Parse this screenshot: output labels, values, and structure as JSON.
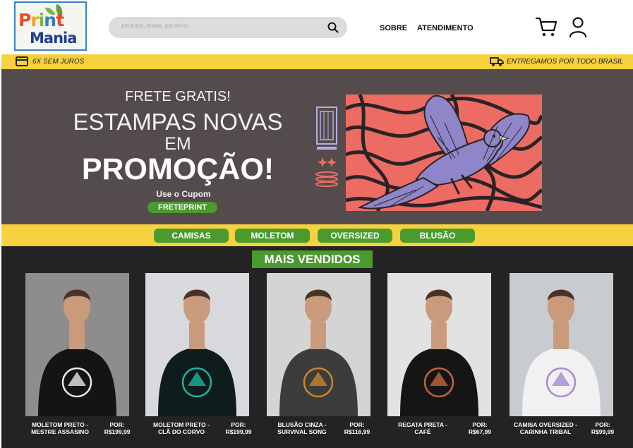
{
  "header": {
    "logo": {
      "line1": "Print",
      "line2": "Mania"
    },
    "search_placeholder": "produtos, temas, parceiros....",
    "nav": {
      "about": "SOBRE",
      "support": "ATENDIMENTO"
    },
    "icons": {
      "search": "search-icon",
      "cart": "cart-icon",
      "user": "user-icon"
    }
  },
  "info_bar": {
    "installments": "6X SEM JUROS",
    "shipping": "ENTREGAMOS POR TODO BRASIL"
  },
  "hero": {
    "line1": "FRETE GRATIS!",
    "line2": "ESTAMPAS NOVAS",
    "line3": "EM",
    "line4": "PROMOÇÃO!",
    "coupon_label": "Use o Cupom",
    "coupon_code": "FRETEPRINT"
  },
  "categories": [
    "CAMISAS",
    "MOLETOM",
    "OVERSIZED",
    "BLUSÃO"
  ],
  "section_title": "MAIS VENDIDOS",
  "products": [
    {
      "name1": "MOLETOM PRETO -",
      "name2": "MESTRE ASSASINO",
      "price_label": "POR:",
      "price": "R$199,99",
      "garment": "#141414",
      "print": "#e8e8e8",
      "bg": "#8f8c8c"
    },
    {
      "name1": "MOLETOM PRETO -",
      "name2": "CLÃ DO CORVO",
      "price_label": "POR:",
      "price": "R$199,99",
      "garment": "#0f1c1c",
      "print": "#1fb3a0",
      "bg": "#d7d9dc"
    },
    {
      "name1": "BLUSÃO CINZA  -",
      "name2": "SURVIVAL SONG",
      "price_label": "POR:",
      "price": "R$116,99",
      "garment": "#3b3d3d",
      "print": "#c9862a",
      "bg": "#d4d4d4"
    },
    {
      "name1": "REGATA PRETA -",
      "name2": "CAFÉ",
      "price_label": "POR:",
      "price": "R$67,99",
      "garment": "#151515",
      "print": "#c0643a",
      "bg": "#e2e2e2"
    },
    {
      "name1": "CAMISA OVERSIZED -",
      "name2": "CARINHA TRIBAL",
      "price_label": "POR:",
      "price": "R$99,99",
      "garment": "#f1f1f1",
      "print": "#a58bd6",
      "bg": "#c8ccd0"
    }
  ],
  "colors": {
    "brand_green": "#4a9a2e",
    "brand_yellow": "#f7d23e",
    "hero_bg": "#544c4c",
    "dark_bg": "#222322",
    "art_red": "#ec6b63",
    "art_purple": "#8f86c9"
  }
}
